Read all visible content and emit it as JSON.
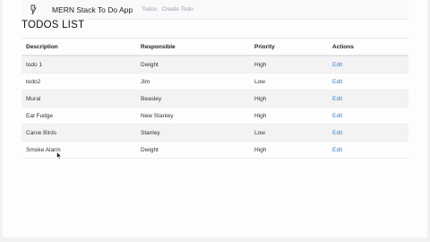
{
  "navbar": {
    "brand": "MERN Stack To Do App",
    "links": [
      "Todos",
      "Create Todo"
    ]
  },
  "page_title": "TODOS LIST",
  "table": {
    "headers": [
      "Description",
      "Responsible",
      "Priority",
      "Actions"
    ],
    "rows": [
      {
        "description": "todo 1",
        "responsible": "Dwight",
        "priority": "High",
        "action": "Edit"
      },
      {
        "description": "todo2",
        "responsible": "Jim",
        "priority": "Low",
        "action": "Edit"
      },
      {
        "description": "Mural",
        "responsible": "Beasley",
        "priority": "High",
        "action": "Edit"
      },
      {
        "description": "Eat Fudge",
        "responsible": "New Stanley",
        "priority": "High",
        "action": "Edit"
      },
      {
        "description": "Carve Birds",
        "responsible": "Stanley",
        "priority": "Low",
        "action": "Edit"
      },
      {
        "description": "Smoke Alarm",
        "responsible": "Dwight",
        "priority": "High",
        "action": "Edit"
      }
    ]
  },
  "colors": {
    "link": "#3b82d6",
    "navbar_bg": "#f8f9fa",
    "striped_row": "#f3f3f3"
  },
  "icons": [
    "logo-icon",
    "mouse-cursor-icon"
  ]
}
